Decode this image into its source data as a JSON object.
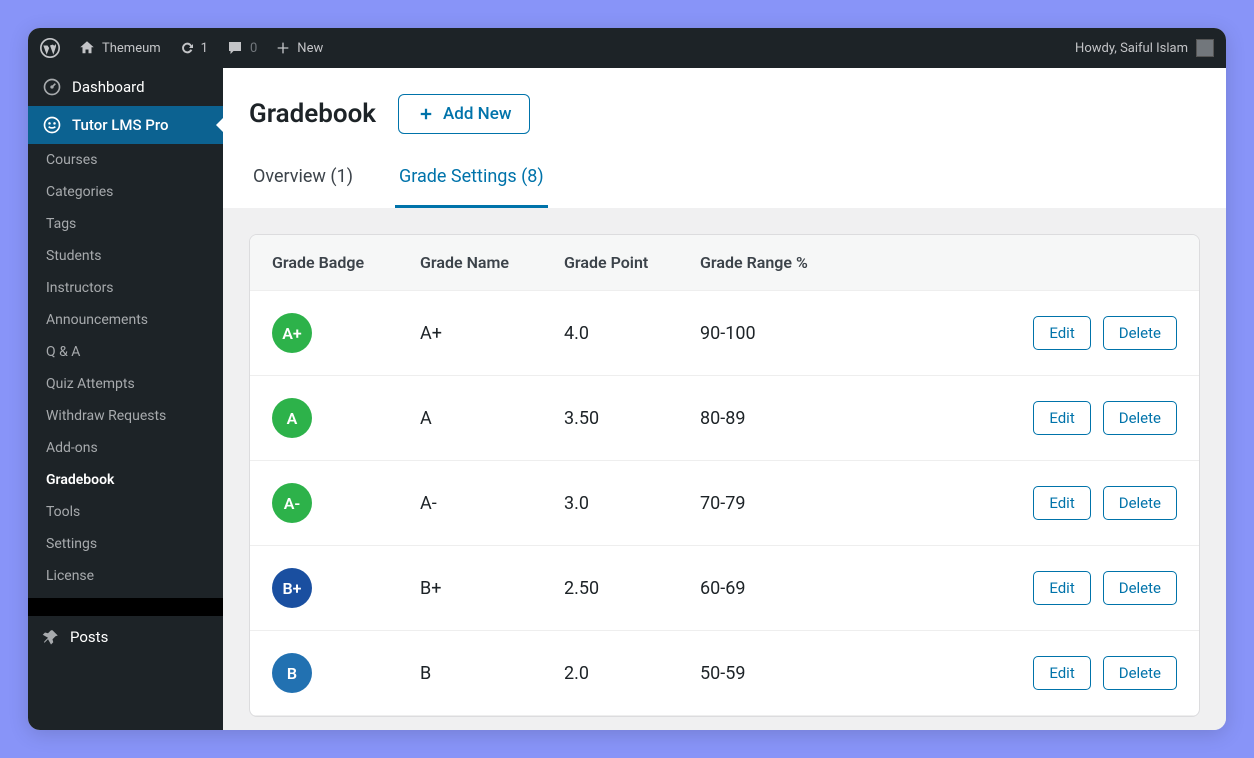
{
  "adminbar": {
    "site_name": "Themeum",
    "updates_count": "1",
    "comments_count": "0",
    "new_label": "New",
    "howdy": "Howdy, Saiful Islam"
  },
  "sidebar": {
    "dashboard": "Dashboard",
    "plugin": "Tutor LMS Pro",
    "items": [
      "Courses",
      "Categories",
      "Tags",
      "Students",
      "Instructors",
      "Announcements",
      "Q & A",
      "Quiz Attempts",
      "Withdraw Requests",
      "Add-ons",
      "Gradebook",
      "Tools",
      "Settings",
      "License"
    ],
    "posts": "Posts"
  },
  "page": {
    "title": "Gradebook",
    "add_new": "Add New",
    "tabs": {
      "overview": "Overview (1)",
      "grade_settings": "Grade Settings (8)"
    }
  },
  "table": {
    "headers": {
      "badge": "Grade Badge",
      "name": "Grade Name",
      "point": "Grade Point",
      "range": "Grade Range %"
    },
    "actions": {
      "edit": "Edit",
      "delete": "Delete"
    },
    "rows": [
      {
        "badge": "A+",
        "name": "A+",
        "point": "4.0",
        "range": "90-100",
        "color": "#2db24a"
      },
      {
        "badge": "A",
        "name": "A",
        "point": "3.50",
        "range": "80-89",
        "color": "#2db24a"
      },
      {
        "badge": "A-",
        "name": "A-",
        "point": "3.0",
        "range": "70-79",
        "color": "#2db24a"
      },
      {
        "badge": "B+",
        "name": "B+",
        "point": "2.50",
        "range": "60-69",
        "color": "#1a4fa0"
      },
      {
        "badge": "B",
        "name": "B",
        "point": "2.0",
        "range": "50-59",
        "color": "#2271b1"
      }
    ]
  }
}
